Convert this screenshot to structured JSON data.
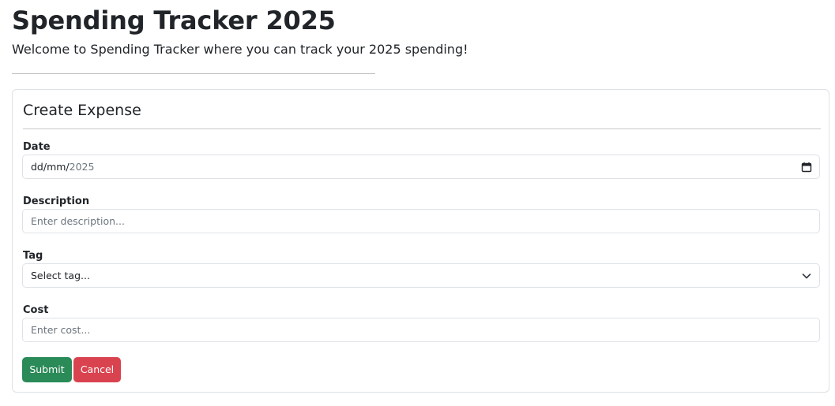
{
  "header": {
    "title": "Spending Tracker 2025",
    "subtitle": "Welcome to Spending Tracker where you can track your 2025 spending!"
  },
  "form": {
    "title": "Create Expense",
    "date": {
      "label": "Date",
      "value_prefix": "dd/mm/",
      "value_year": "2025",
      "icon": "calendar-icon"
    },
    "description": {
      "label": "Description",
      "placeholder": "Enter description..."
    },
    "tag": {
      "label": "Tag",
      "selected": "Select tag...",
      "icon": "chevron-down-icon"
    },
    "cost": {
      "label": "Cost",
      "placeholder": "Enter cost..."
    },
    "submit_label": "Submit",
    "cancel_label": "Cancel"
  },
  "colors": {
    "submit": "#2a8a58",
    "cancel": "#d9434f",
    "text": "#212529",
    "placeholder": "#6c757d",
    "border": "#dee2e6"
  }
}
